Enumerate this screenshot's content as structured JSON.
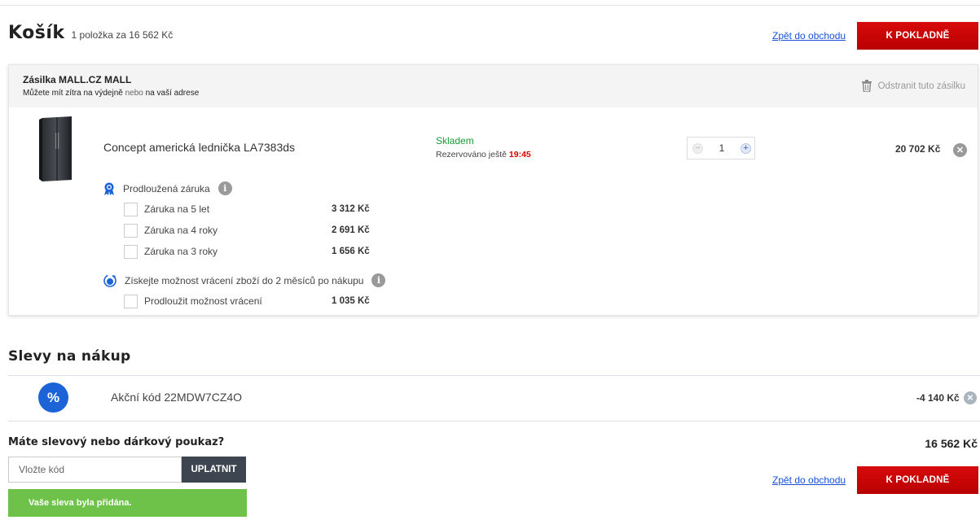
{
  "cart": {
    "title": "Košík",
    "summary": "1 položka za 16 562 Kč",
    "back_link": "Zpět do obchodu",
    "checkout_label": "K POKLADNĚ"
  },
  "shipment": {
    "title": "Zásilka MALL.CZ MALL",
    "sub_part1": "Můžete mít zítra na výdejně",
    "sub_or": "nebo",
    "sub_part2": "na vaší adrese",
    "remove_label": "Odstranit tuto zásilku"
  },
  "product": {
    "name": "Concept americká lednička LA7383ds",
    "stock": "Skladem",
    "reserved_label": "Rezervováno ještě",
    "reserved_time": "19:45",
    "quantity": "1",
    "price": "20 702 Kč"
  },
  "warranty": {
    "title": "Prodloužená záruka",
    "options": [
      {
        "label": "Záruka na 5 let",
        "price": "3 312 Kč"
      },
      {
        "label": "Záruka na 4 roky",
        "price": "2 691 Kč"
      },
      {
        "label": "Záruka na 3 roky",
        "price": "1 656 Kč"
      }
    ]
  },
  "returns": {
    "title": "Získejte možnost vrácení zboží do 2 měsíců po nákupu",
    "option": {
      "label": "Prodloužit možnost vrácení",
      "price": "1 035 Kč"
    }
  },
  "discounts": {
    "title": "Slevy na nákup",
    "badge": "%",
    "code": "Akční kód 22MDW7CZ4O",
    "value": "-4 140 Kč"
  },
  "voucher": {
    "question": "Máte slevový nebo dárkový poukaz?",
    "placeholder": "Vložte kód",
    "apply_label": "UPLATNIT",
    "success": "Vaše sleva byla přidána.",
    "total": "16 562 Kč"
  },
  "colors": {
    "accent_red": "#c80000",
    "link_blue": "#1a4fd6",
    "stock_green": "#1a9a3a",
    "success_green": "#6ec24a",
    "badge_blue": "#1b63d6"
  }
}
